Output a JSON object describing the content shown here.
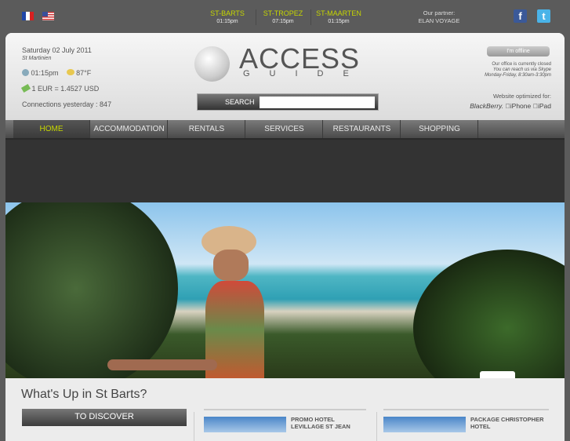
{
  "topbar": {
    "languages": [
      "fr",
      "en"
    ],
    "cities": [
      {
        "name": "ST-BARTS",
        "time": "01:15pm"
      },
      {
        "name": "ST-TROPEZ",
        "time": "07:15pm"
      },
      {
        "name": "ST-MAARTEN",
        "time": "01:15pm"
      }
    ],
    "partner_label": "Our partner:",
    "partner_name": "ELAN VOYAGE",
    "social": [
      "facebook-icon",
      "twitter-icon"
    ]
  },
  "header": {
    "date": "Saturday 02 July 2011",
    "saint": "St Martinien",
    "time": "01:15pm",
    "temp": "87°F",
    "rate": "1 EUR = 1.4527 USD",
    "connections": "Connections yesterday : 847",
    "logo_top": "ACCESS",
    "logo_bottom": "GUIDE",
    "search_label": "SEARCH",
    "search_value": "",
    "status": "I'm offline",
    "office_closed": "Our office is currently closed",
    "skype": "You can reach us via Skype",
    "hours": "Monday-Friday, 8:30am-3:30pm",
    "optimized": "Website optimized for:",
    "devices": [
      "BlackBerry.",
      "iPhone",
      "iPad"
    ]
  },
  "nav": [
    "HOME",
    "ACCOMMODATION",
    "RENTALS",
    "SERVICES",
    "RESTAURANTS",
    "SHOPPING"
  ],
  "accent": "#c6d600",
  "main": {
    "title": "What's Up in St Barts?",
    "discover": "TO DISCOVER",
    "promos": [
      {
        "title": "PROMO HOTEL LEVILLAGE ST JEAN"
      },
      {
        "title": "PACKAGE CHRISTOPHER HOTEL"
      }
    ]
  }
}
